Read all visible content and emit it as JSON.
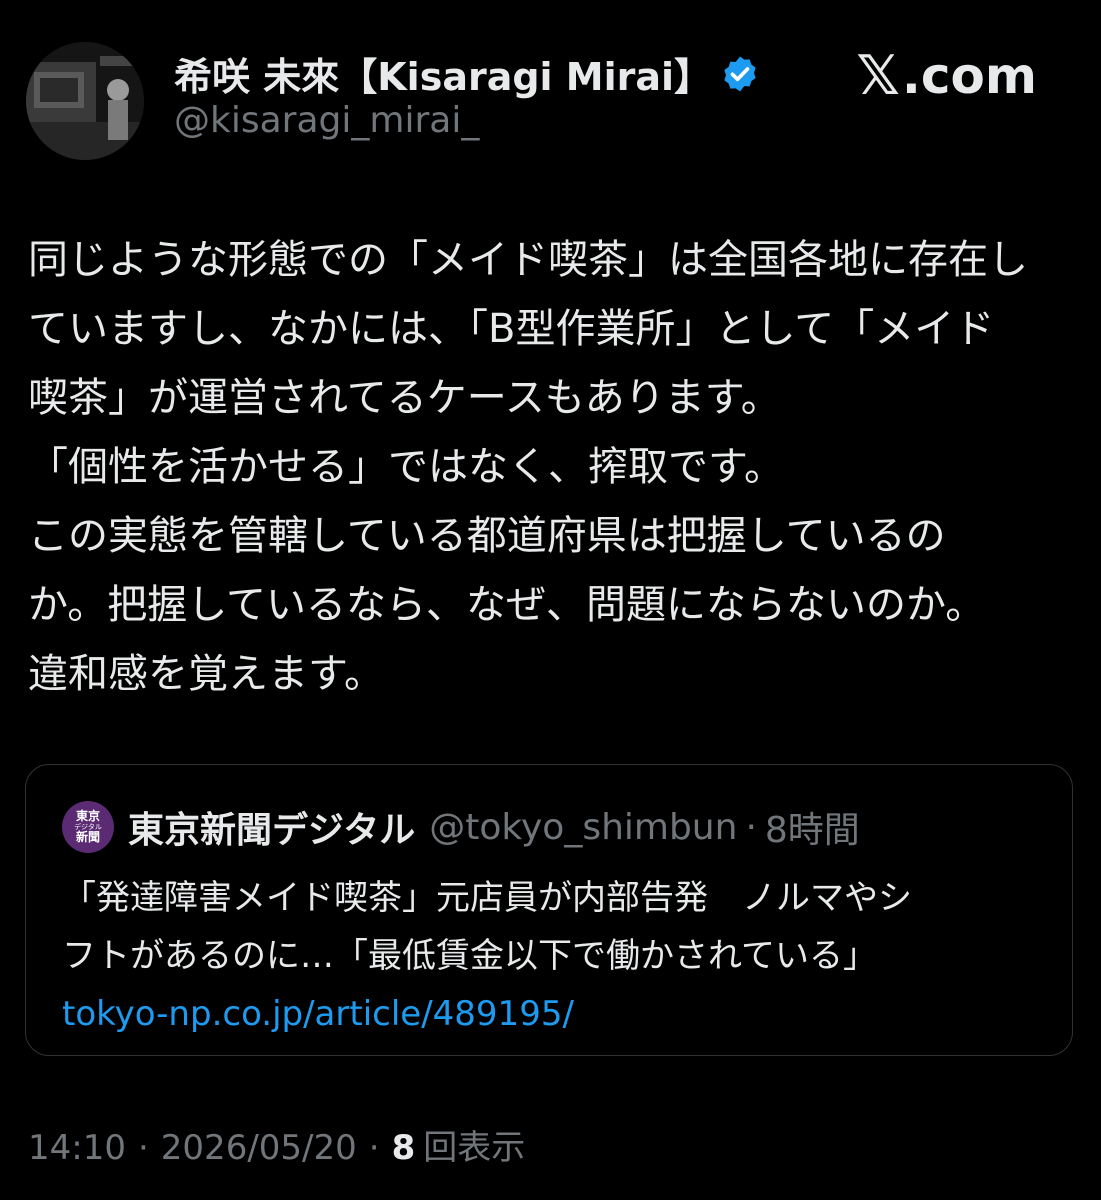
{
  "author": {
    "display_name": "希咲 未來【Kisaragi Mirai】",
    "handle": "@kisaragi_mirai_",
    "verified_color": "#1d9bf0"
  },
  "brand": {
    "glyph": "𝕏",
    "text": ".com"
  },
  "tweet": {
    "lines": [
      "同じような形態での「メイド喫茶」は全国各地に存在し",
      "ていますし、なかには、「B型作業所」として「メイド",
      "喫茶」が運営されてるケースもあります。",
      "「個性を活かせる」ではなく、搾取です。",
      "この実態を管轄している都道府県は把握しているの",
      "か。把握しているなら、なぜ、問題にならないのか。",
      "違和感を覚えます。"
    ]
  },
  "quote": {
    "avatar_text": {
      "top": "東京",
      "middle": "デジタル",
      "bottom": "新聞"
    },
    "avatar_color": "#5a2a73",
    "name": "東京新聞デジタル",
    "handle": "@tokyo_shimbun",
    "separator": "·",
    "time": "8時間",
    "text_lines": [
      "「発達障害メイド喫茶」元店員が内部告発　ノルマやシ",
      "フトがあるのに…「最低賃金以下で働かされている」"
    ],
    "link": "tokyo-np.co.jp/article/489195/",
    "link_color": "#1d9bf0"
  },
  "meta": {
    "time": "14:10",
    "separator": "·",
    "date": "2026/05/20",
    "views_count": "8",
    "views_label": "回表示"
  }
}
